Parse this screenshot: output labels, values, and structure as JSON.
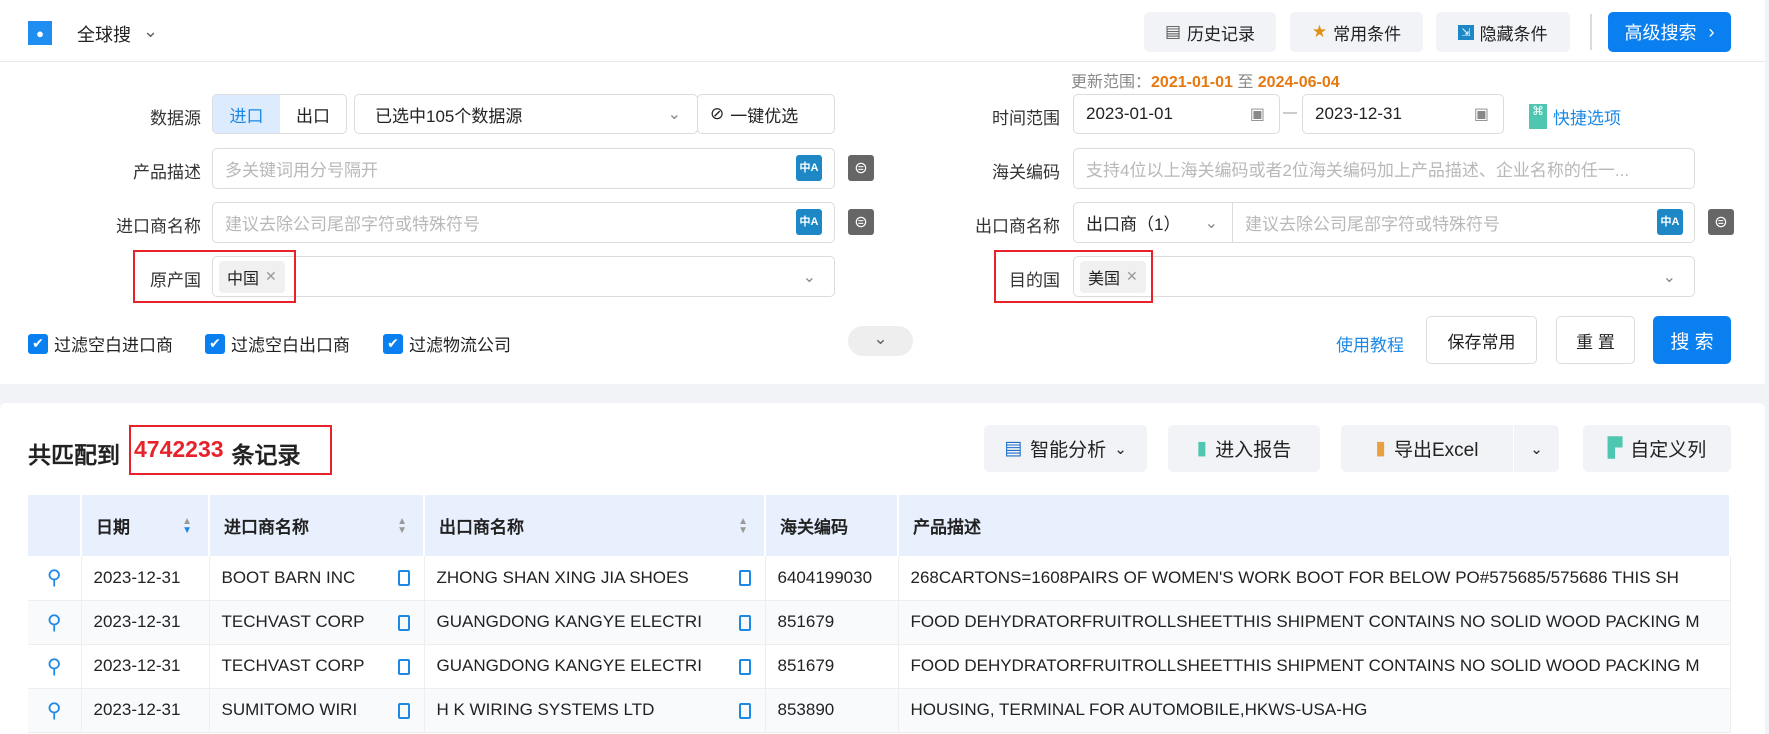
{
  "header": {
    "app_name": "全球搜",
    "history": "历史记录",
    "favorites": "常用条件",
    "hide": "隐藏条件",
    "advanced": "高级搜索"
  },
  "filters": {
    "update_range_label": "更新范围：",
    "update_start": "2021-01-01",
    "update_to": "至",
    "update_end": "2024-06-04",
    "datasource_label": "数据源",
    "import_tab": "进口",
    "export_tab": "出口",
    "datasource_value": "已选中105个数据源",
    "one_click": "一键优选",
    "time_label": "时间范围",
    "date_start": "2023-01-01",
    "date_end": "2023-12-31",
    "quick_options": "快捷选项",
    "product_label": "产品描述",
    "product_placeholder": "多关键词用分号隔开",
    "hs_label": "海关编码",
    "hs_placeholder": "支持4位以上海关编码或者2位海关编码加上产品描述、企业名称的任一...",
    "importer_label": "进口商名称",
    "importer_placeholder": "建议去除公司尾部字符或特殊符号",
    "exporter_label": "出口商名称",
    "exporter_select": "出口商（1）",
    "exporter_placeholder": "建议去除公司尾部字符或特殊符号",
    "origin_label": "原产国",
    "origin_tag": "中国",
    "dest_label": "目的国",
    "dest_tag": "美国",
    "checkboxes": [
      "过滤空白进口商",
      "过滤空白出口商",
      "过滤物流公司"
    ],
    "tutorial": "使用教程",
    "save": "保存常用",
    "reset": "重 置",
    "search": "搜 索"
  },
  "results": {
    "prefix": "共匹配到",
    "count": "4742233",
    "suffix": "条记录",
    "tools": {
      "analysis": "智能分析",
      "report": "进入报告",
      "export": "导出Excel",
      "columns": "自定义列"
    },
    "columns": [
      "日期",
      "进口商名称",
      "出口商名称",
      "海关编码",
      "产品描述"
    ],
    "rows": [
      {
        "date": "2023-12-31",
        "importer": "BOOT BARN INC",
        "exporter": "ZHONG SHAN XING JIA SHOES",
        "hs": "6404199030",
        "desc": "268CARTONS=1608PAIRS OF WOMEN'S WORK BOOT FOR BELOW PO#575685/575686 THIS SH"
      },
      {
        "date": "2023-12-31",
        "importer": "TECHVAST CORP",
        "exporter": "GUANGDONG KANGYE ELECTRI",
        "hs": "851679",
        "desc": "FOOD DEHYDRATORFRUITROLLSHEETTHIS SHIPMENT CONTAINS NO SOLID WOOD PACKING M"
      },
      {
        "date": "2023-12-31",
        "importer": "TECHVAST CORP",
        "exporter": "GUANGDONG KANGYE ELECTRI",
        "hs": "851679",
        "desc": "FOOD DEHYDRATORFRUITROLLSHEETTHIS SHIPMENT CONTAINS NO SOLID WOOD PACKING M"
      },
      {
        "date": "2023-12-31",
        "importer": "SUMITOMO WIRI",
        "exporter": "H K WIRING SYSTEMS LTD",
        "hs": "853890",
        "desc": "HOUSING, TERMINAL FOR AUTOMOBILE,HKWS-USA-HG"
      }
    ]
  },
  "colors": {
    "accent": "#0a7ff0",
    "orange": "#e6780f",
    "red": "#e8222a"
  }
}
